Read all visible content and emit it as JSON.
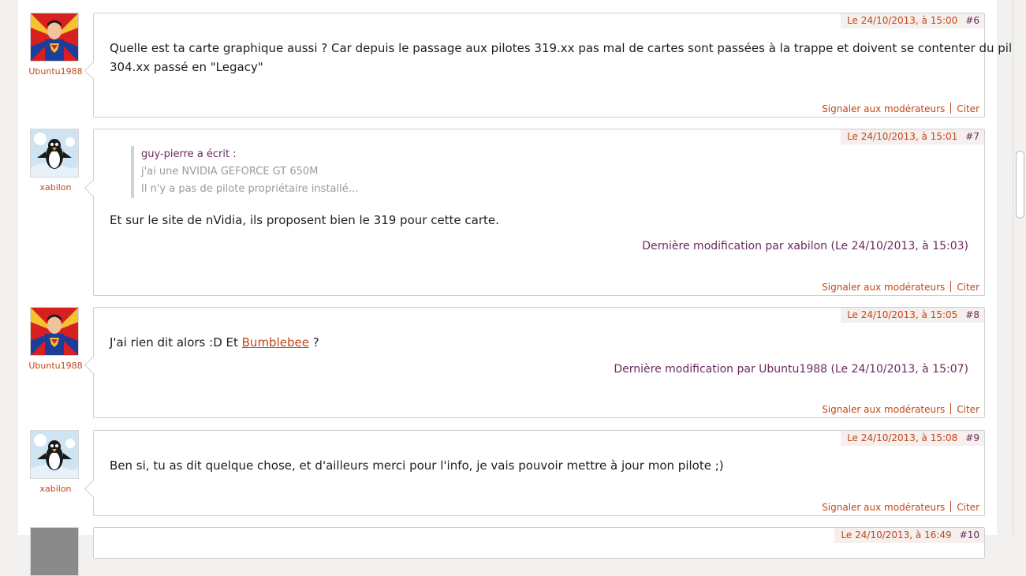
{
  "labels": {
    "report": "Signaler aux modérateurs",
    "cite": "Citer"
  },
  "posts": [
    {
      "author": "Ubuntu1988",
      "avatar": "superman-avatar",
      "date": "Le 24/10/2013, à 15:00",
      "number": "#6",
      "text_line1": "Quelle est ta carte graphique aussi ? Car depuis le passage aux pilotes 319.xx pas mal de cartes sont passées à la trappe et doivent se contenter du pilote",
      "text_line2": "304.xx passé en \"Legacy\""
    },
    {
      "author": "xabilon",
      "avatar": "penguin-avatar",
      "date": "Le 24/10/2013, à 15:01",
      "number": "#7",
      "quote_head": "guy-pierre a écrit :",
      "quote_line1": "j'ai une NVIDIA GEFORCE  GT 650M",
      "quote_line2": "Il n'y a pas de pilote propriétaire installé...",
      "text": "Et sur le site de nVidia, ils proposent bien le 319 pour cette carte.",
      "edited": "Dernière modification par xabilon (Le 24/10/2013, à 15:03)"
    },
    {
      "author": "Ubuntu1988",
      "avatar": "superman-avatar",
      "date": "Le 24/10/2013, à 15:05",
      "number": "#8",
      "text_before": "J'ai rien dit alors :D Et ",
      "link": "Bumblebee",
      "text_after": " ?",
      "edited": "Dernière modification par Ubuntu1988 (Le 24/10/2013, à 15:07)"
    },
    {
      "author": "xabilon",
      "avatar": "penguin-avatar",
      "date": "Le 24/10/2013, à 15:08",
      "number": "#9",
      "text": "Ben si, tu as dit quelque chose, et d'ailleurs merci pour l'info, je vais pouvoir mettre à jour mon pilote ;)"
    },
    {
      "author": "",
      "avatar": "user-avatar",
      "date": "Le 24/10/2013, à 16:49",
      "number": "#10"
    }
  ]
}
